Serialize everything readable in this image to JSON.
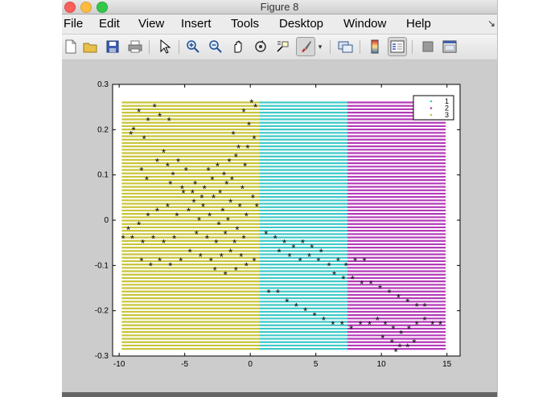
{
  "window": {
    "title": "Figure 8"
  },
  "menubar": {
    "items": [
      "File",
      "Edit",
      "View",
      "Insert",
      "Tools",
      "Desktop",
      "Window",
      "Help"
    ],
    "end_icon": "arrow-icon"
  },
  "toolbar": {
    "icons": [
      "new-figure-icon",
      "open-icon",
      "save-icon",
      "print-icon",
      "pointer-icon",
      "zoom-in-icon",
      "zoom-out-icon",
      "pan-icon",
      "rotate-3d-icon",
      "data-cursor-icon",
      "brush-icon",
      "brush-dropdown-icon",
      "link-icon",
      "colorbar-icon",
      "legend-icon",
      "hide-plot-tools-icon",
      "show-plot-tools-icon"
    ],
    "pressed": [
      "legend-icon",
      "brush-icon"
    ]
  },
  "colors": {
    "region1": "#c8c53a",
    "region2": "#3ec9c7",
    "region3": "#b43ab8",
    "markers": "#000000",
    "figure_bg": "#cccccc",
    "axes_bg": "#ffffff"
  },
  "chart_data": {
    "type": "scatter",
    "title": "",
    "xlabel": "",
    "ylabel": "",
    "xlim": [
      -10.5,
      16
    ],
    "ylim": [
      -0.3,
      0.3
    ],
    "xticks": [
      "-10",
      "-5",
      "0",
      "5",
      "10",
      "15"
    ],
    "xtick_values": [
      -10,
      -5,
      0,
      5,
      10,
      15
    ],
    "yticks": [
      "-0.3",
      "-0.2",
      "-0.1",
      "0",
      "0.1",
      "0.2",
      "0.3"
    ],
    "ytick_values": [
      -0.3,
      -0.2,
      -0.1,
      0,
      0.1,
      0.2,
      0.3
    ],
    "grid": false,
    "legend": {
      "position": "top-right",
      "entries": [
        {
          "label": "1",
          "color": "#3ec9c7"
        },
        {
          "label": "2",
          "color": "#b43ab8"
        },
        {
          "label": "3",
          "color": "#c8c53a"
        }
      ]
    },
    "regions": [
      {
        "label": "3",
        "x_range": [
          -9.8,
          0.7
        ],
        "y_range": [
          -0.29,
          0.26
        ],
        "color": "#c8c53a"
      },
      {
        "label": "1",
        "x_range": [
          0.7,
          7.4
        ],
        "y_range": [
          -0.29,
          0.26
        ],
        "color": "#3ec9c7"
      },
      {
        "label": "2",
        "x_range": [
          7.4,
          14.9
        ],
        "y_range": [
          -0.29,
          0.26
        ],
        "color": "#b43ab8"
      }
    ],
    "points": [
      [
        -8.5,
        0.24
      ],
      [
        -7.8,
        0.22
      ],
      [
        -8.9,
        0.2
      ],
      [
        -6.9,
        0.23
      ],
      [
        -7.3,
        0.25
      ],
      [
        -9.1,
        0.19
      ],
      [
        -8.1,
        0.18
      ],
      [
        -6.2,
        0.22
      ],
      [
        -6.6,
        0.15
      ],
      [
        -7.1,
        0.13
      ],
      [
        -6.3,
        0.12
      ],
      [
        -5.5,
        0.13
      ],
      [
        -5.9,
        0.1
      ],
      [
        -4.9,
        0.11
      ],
      [
        -6.1,
        0.08
      ],
      [
        -5.2,
        0.07
      ],
      [
        -8.3,
        0.11
      ],
      [
        -7.9,
        0.09
      ],
      [
        -1.3,
        0.19
      ],
      [
        -0.5,
        0.24
      ],
      [
        0.1,
        0.26
      ],
      [
        -0.1,
        0.21
      ],
      [
        -0.9,
        0.16
      ],
      [
        -1.6,
        0.13
      ],
      [
        -0.4,
        0.12
      ],
      [
        0.4,
        0.25
      ],
      [
        0.3,
        0.18
      ],
      [
        -0.2,
        0.16
      ],
      [
        -1.1,
        0.14
      ],
      [
        -5.1,
        0.06
      ],
      [
        -4.3,
        0.04
      ],
      [
        -3.6,
        0.03
      ],
      [
        -2.8,
        0.05
      ],
      [
        -2.1,
        0.02
      ],
      [
        -1.5,
        0.04
      ],
      [
        -0.8,
        0.03
      ],
      [
        -4.7,
        0.02
      ],
      [
        -3.9,
        0.0
      ],
      [
        -3.1,
        0.01
      ],
      [
        -2.4,
        -0.01
      ],
      [
        -1.7,
        0.0
      ],
      [
        -1.0,
        -0.02
      ],
      [
        -0.3,
        0.01
      ],
      [
        -5.6,
        0.01
      ],
      [
        -6.3,
        0.03
      ],
      [
        -7.1,
        0.02
      ],
      [
        -7.8,
        0.01
      ],
      [
        -8.5,
        -0.01
      ],
      [
        -9.3,
        -0.02
      ],
      [
        -4.1,
        -0.03
      ],
      [
        -3.3,
        -0.04
      ],
      [
        -2.6,
        -0.05
      ],
      [
        -1.9,
        -0.03
      ],
      [
        -1.2,
        -0.05
      ],
      [
        -0.5,
        -0.04
      ],
      [
        -5.8,
        -0.04
      ],
      [
        -6.6,
        -0.05
      ],
      [
        -7.4,
        -0.04
      ],
      [
        -8.2,
        -0.05
      ],
      [
        -9.0,
        -0.04
      ],
      [
        -9.7,
        -0.04
      ],
      [
        -4.6,
        -0.07
      ],
      [
        -3.8,
        -0.08
      ],
      [
        -3.0,
        -0.09
      ],
      [
        -2.2,
        -0.08
      ],
      [
        -1.5,
        -0.07
      ],
      [
        -0.7,
        -0.08
      ],
      [
        -5.3,
        -0.09
      ],
      [
        -6.1,
        -0.1
      ],
      [
        -6.9,
        -0.09
      ],
      [
        -7.6,
        -0.1
      ],
      [
        -8.3,
        -0.09
      ],
      [
        -2.7,
        -0.11
      ],
      [
        -1.9,
        -0.12
      ],
      [
        -1.1,
        -0.11
      ],
      [
        -0.3,
        -0.1
      ],
      [
        0.3,
        -0.09
      ],
      [
        -4.2,
        0.08
      ],
      [
        -3.5,
        0.07
      ],
      [
        -2.9,
        0.09
      ],
      [
        -2.3,
        0.06
      ],
      [
        -1.8,
        0.08
      ],
      [
        -3.2,
        0.11
      ],
      [
        -2.5,
        0.12
      ],
      [
        -3.7,
        0.05
      ],
      [
        -4.4,
        0.06
      ],
      [
        -2.0,
        0.1
      ],
      [
        -1.4,
        0.09
      ],
      [
        -0.6,
        0.07
      ],
      [
        0.2,
        0.05
      ],
      [
        0.5,
        0.03
      ],
      [
        1.2,
        -0.03
      ],
      [
        1.9,
        -0.04
      ],
      [
        2.6,
        -0.05
      ],
      [
        3.3,
        -0.06
      ],
      [
        4.0,
        -0.05
      ],
      [
        4.7,
        -0.06
      ],
      [
        5.4,
        -0.07
      ],
      [
        2.2,
        -0.07
      ],
      [
        3.0,
        -0.08
      ],
      [
        3.8,
        -0.09
      ],
      [
        4.5,
        -0.08
      ],
      [
        5.2,
        -0.09
      ],
      [
        6.0,
        -0.1
      ],
      [
        6.7,
        -0.09
      ],
      [
        7.3,
        -0.1
      ],
      [
        8.0,
        -0.09
      ],
      [
        8.7,
        -0.09
      ],
      [
        6.4,
        -0.12
      ],
      [
        7.1,
        -0.13
      ],
      [
        7.8,
        -0.13
      ],
      [
        8.5,
        -0.14
      ],
      [
        9.2,
        -0.14
      ],
      [
        9.9,
        -0.15
      ],
      [
        10.6,
        -0.16
      ],
      [
        11.3,
        -0.17
      ],
      [
        12.0,
        -0.18
      ],
      [
        12.7,
        -0.19
      ],
      [
        13.3,
        -0.19
      ],
      [
        1.4,
        -0.16
      ],
      [
        2.1,
        -0.16
      ],
      [
        2.8,
        -0.18
      ],
      [
        3.5,
        -0.19
      ],
      [
        4.2,
        -0.2
      ],
      [
        4.9,
        -0.21
      ],
      [
        5.6,
        -0.22
      ],
      [
        6.3,
        -0.23
      ],
      [
        7.0,
        -0.23
      ],
      [
        7.7,
        -0.24
      ],
      [
        8.4,
        -0.23
      ],
      [
        9.1,
        -0.23
      ],
      [
        9.7,
        -0.22
      ],
      [
        10.3,
        -0.23
      ],
      [
        10.9,
        -0.24
      ],
      [
        11.5,
        -0.25
      ],
      [
        12.1,
        -0.24
      ],
      [
        12.7,
        -0.23
      ],
      [
        13.3,
        -0.22
      ],
      [
        13.9,
        -0.23
      ],
      [
        14.5,
        -0.23
      ],
      [
        10.1,
        -0.26
      ],
      [
        10.8,
        -0.27
      ],
      [
        11.4,
        -0.28
      ],
      [
        12.0,
        -0.28
      ],
      [
        12.5,
        -0.27
      ],
      [
        11.1,
        -0.29
      ]
    ]
  }
}
